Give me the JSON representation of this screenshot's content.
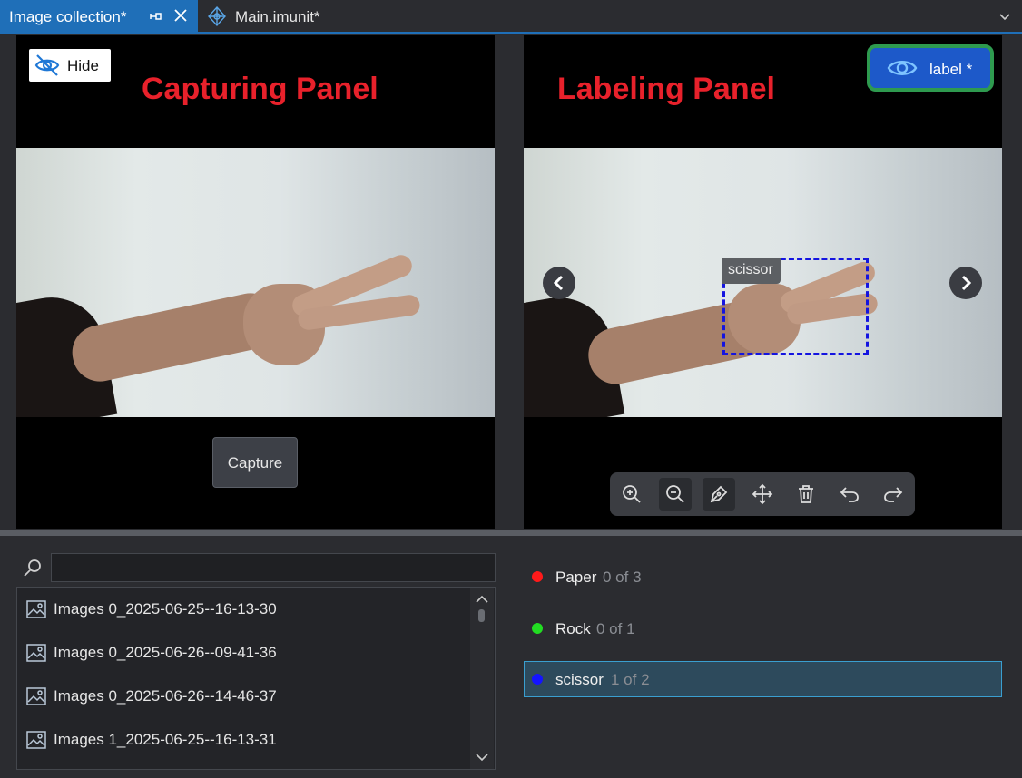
{
  "tabs": [
    {
      "label": "Image collection*"
    },
    {
      "label": "Main.imunit*"
    }
  ],
  "capture_panel": {
    "title": "Capturing Panel",
    "hide_label": "Hide",
    "capture_label": "Capture"
  },
  "label_panel": {
    "title": "Labeling Panel",
    "label_button": "label *",
    "bbox_label": "scissor"
  },
  "toolbar": {
    "tools": [
      "zoom-in-icon",
      "zoom-out-icon",
      "pen-icon",
      "move-icon",
      "trash-icon",
      "undo-icon",
      "redo-icon"
    ]
  },
  "search": {
    "value": ""
  },
  "image_list": [
    "Images 0_2025-06-25--16-13-30",
    "Images 0_2025-06-26--09-41-36",
    "Images 0_2025-06-26--14-46-37",
    "Images 1_2025-06-25--16-13-31"
  ],
  "classes": [
    {
      "name": "Paper",
      "count": "0 of 3",
      "color": "#ff1a1a"
    },
    {
      "name": "Rock",
      "count": "0 of 1",
      "color": "#22dd22"
    },
    {
      "name": "scissor",
      "count": "1 of 2",
      "color": "#1414ff"
    }
  ],
  "colors": {
    "accent": "#1f6fb8",
    "panel_title": "#e8212b"
  }
}
